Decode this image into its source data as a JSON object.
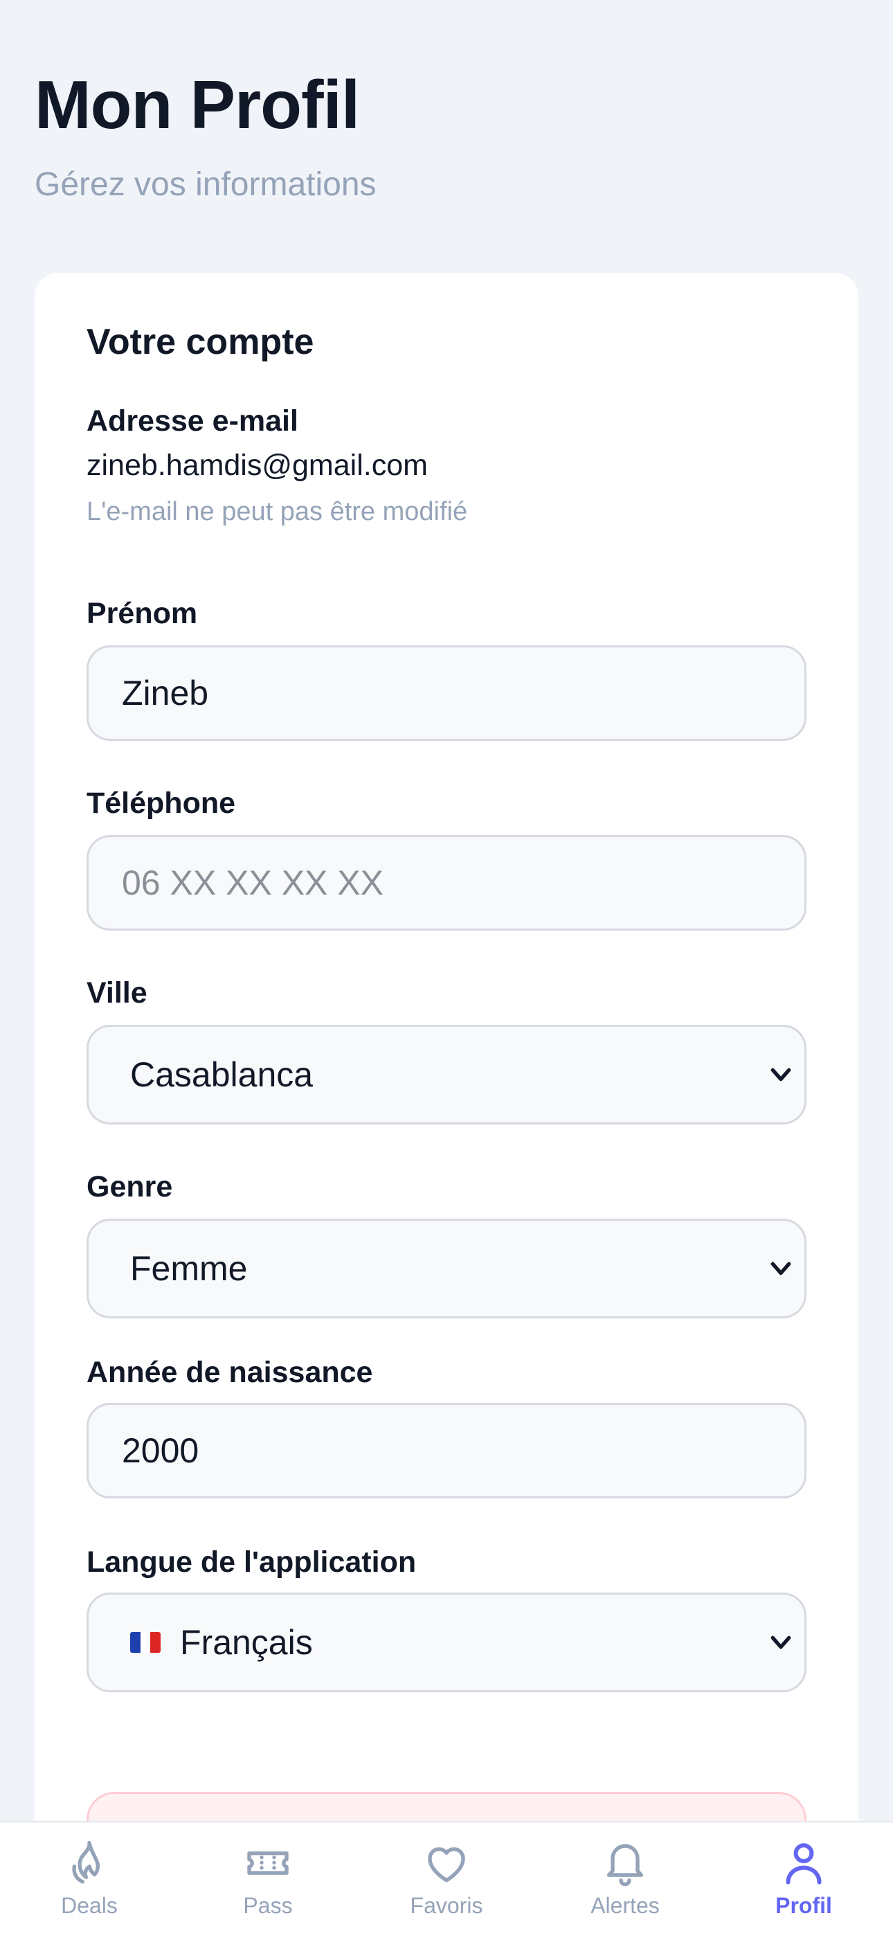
{
  "header": {
    "title": "Mon Profil",
    "subtitle": "Gérez vos informations"
  },
  "account": {
    "section_title": "Votre compte",
    "email_label": "Adresse e-mail",
    "email_value": "zineb.hamdis@gmail.com",
    "email_hint": "L'e-mail ne peut pas être modifié",
    "first_name_label": "Prénom",
    "first_name_value": "Zineb",
    "phone_label": "Téléphone",
    "phone_placeholder": "06 XX XX XX XX",
    "city_label": "Ville",
    "city_value": "Casablanca",
    "gender_label": "Genre",
    "gender_value": "Femme",
    "birth_year_label": "Année de naissance",
    "birth_year_value": "2000",
    "language_label": "Langue de l'application",
    "language_value": "Français",
    "language_flag_icon": "flag-france-icon"
  },
  "tabbar": {
    "items": [
      {
        "label": "Deals",
        "icon": "flame-icon"
      },
      {
        "label": "Pass",
        "icon": "ticket-icon"
      },
      {
        "label": "Favoris",
        "icon": "heart-icon"
      },
      {
        "label": "Alertes",
        "icon": "bell-icon"
      },
      {
        "label": "Profil",
        "icon": "user-icon"
      }
    ],
    "active_index": 4
  },
  "colors": {
    "accent": "#6366f1",
    "muted": "#94a3b8",
    "danger_bg": "#fff1f2"
  }
}
